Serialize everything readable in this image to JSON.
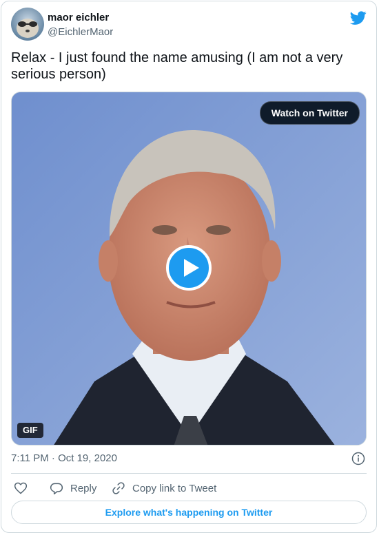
{
  "author": {
    "name": "maor eichler",
    "handle": "@EichlerMaor"
  },
  "tweet": {
    "text": "Relax - I just found the name amusing (I am not a very serious person)",
    "timestamp": "7:11 PM · Oct 19, 2020"
  },
  "media": {
    "watch_label": "Watch on Twitter",
    "badge": "GIF"
  },
  "actions": {
    "reply_label": "Reply",
    "copy_label": "Copy link to Tweet"
  },
  "explore_label": "Explore what's happening on Twitter",
  "icons": {
    "brand": "twitter-bird-icon",
    "play": "play-icon",
    "info": "info-icon",
    "like": "heart-icon",
    "reply": "reply-bubble-icon",
    "copy": "link-icon"
  },
  "colors": {
    "accent": "#1d9bf0",
    "text_primary": "#0f1419",
    "text_secondary": "#536471",
    "border": "#cfd9de"
  }
}
